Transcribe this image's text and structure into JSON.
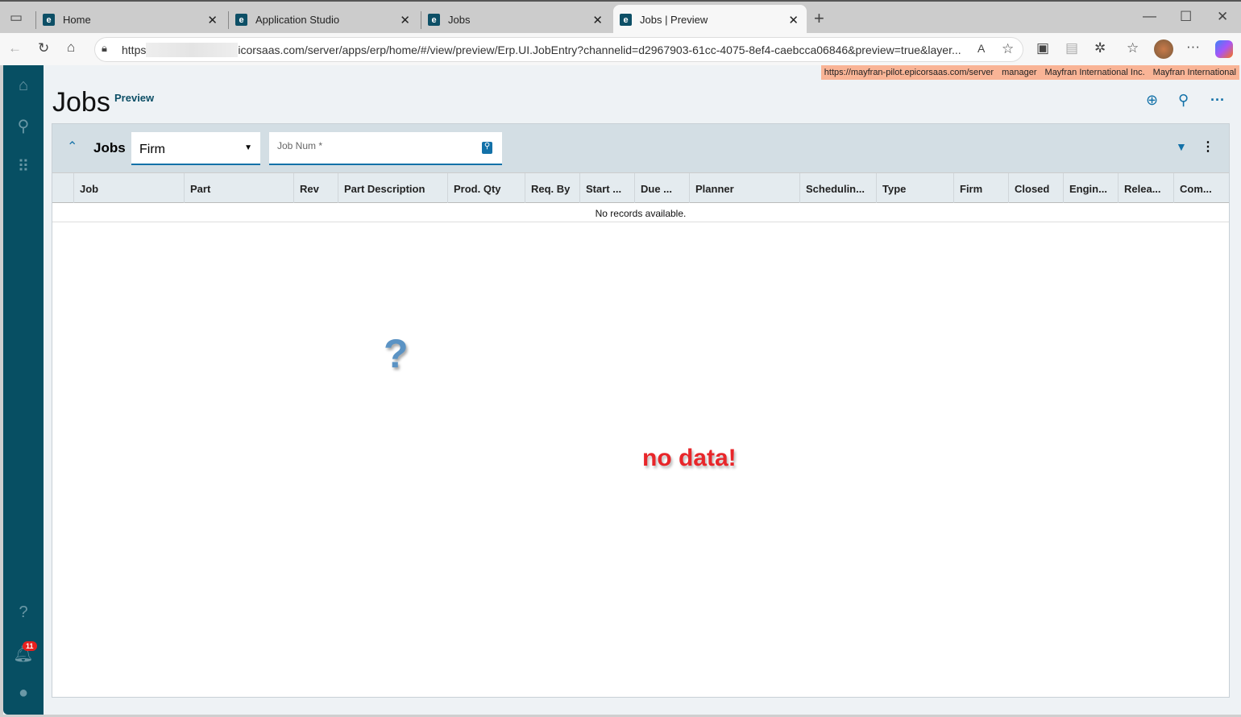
{
  "browser": {
    "tabs": [
      {
        "label": "Home"
      },
      {
        "label": "Application Studio"
      },
      {
        "label": "Jobs"
      },
      {
        "label": "Jobs | Preview"
      }
    ],
    "url_prefix": "https",
    "url_rest": "icorsaas.com/server/apps/erp/home/#/view/preview/Erp.UI.JobEntry?channelid=d2967903-61cc-4075-8ef4-caebcca06846&preview=true&layer...",
    "info": [
      "https://mayfran-pilot.epicorsaas.com/server",
      "manager",
      "Mayfran International Inc.",
      "Mayfran International"
    ]
  },
  "page": {
    "title": "Jobs",
    "badge": "Preview"
  },
  "panel": {
    "title": "Jobs",
    "select_value": "Firm",
    "job_num_label": "Job Num *"
  },
  "grid": {
    "columns": [
      "Job",
      "Part",
      "Rev",
      "Part Description",
      "Prod. Qty",
      "Req. By",
      "Start ...",
      "Due ...",
      "Planner",
      "Schedulin...",
      "Type",
      "Firm",
      "Closed",
      "Engin...",
      "Relea...",
      "Com..."
    ],
    "empty_text": "No records available."
  },
  "annotation": {
    "text": "no data!",
    "symbol": "?"
  },
  "sidebar": {
    "notification_count": "11"
  }
}
